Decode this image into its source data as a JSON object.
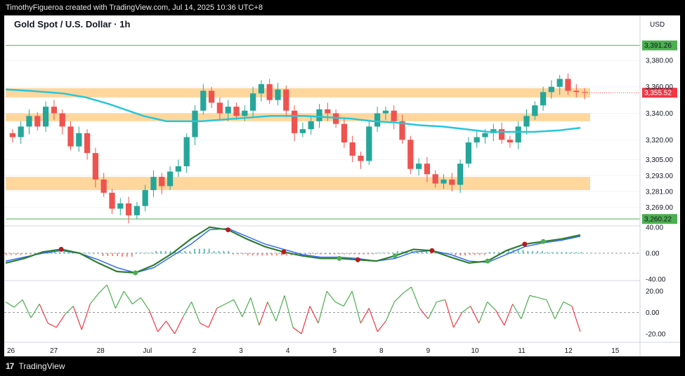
{
  "header": {
    "text": "TimothyFigueroa created with TradingView.com, Jul 14, 2025 10:36 UTC+8"
  },
  "footer": {
    "brand": "TradingView"
  },
  "chart_data": [
    {
      "type": "candlestick",
      "title": "Gold Spot / U.S. Dollar · 1h",
      "currency": "USD",
      "y_ticks": [
        3380.0,
        3360.0,
        3340.0,
        3320.0,
        3305.0,
        3293.0,
        3281.0,
        3269.0
      ],
      "y_tick_labels": [
        "3,380.00",
        "3,360.00",
        "3,340.00",
        "3,320.00",
        "3,305.00",
        "3,293.00",
        "3,281.00",
        "3,269.00"
      ],
      "ylim": [
        3255,
        3398
      ],
      "x_labels": [
        "26",
        "27",
        "28",
        "Jul",
        "2",
        "3",
        "4",
        "5",
        "8",
        "9",
        "10",
        "11",
        "12",
        "15"
      ],
      "horizontal_lines": [
        {
          "value": 3391.26,
          "label": "3,391.26",
          "color": "#4caf50"
        },
        {
          "value": 3260.22,
          "label": "3,260.22",
          "color": "#4caf50"
        }
      ],
      "last_price": {
        "value": 3355.52,
        "label": "3,355.52",
        "color": "#f23645"
      },
      "zones": [
        {
          "from": 3352,
          "to": 3359,
          "color": "#ffb74d"
        },
        {
          "from": 3334,
          "to": 3340,
          "color": "#ffb74d"
        },
        {
          "from": 3282,
          "to": 3292,
          "color": "#ffb74d"
        }
      ],
      "closes": [
        3322,
        3330,
        3338,
        3330,
        3345,
        3340,
        3330,
        3315,
        3325,
        3310,
        3290,
        3280,
        3268,
        3272,
        3263,
        3270,
        3282,
        3292,
        3285,
        3296,
        3300,
        3322,
        3342,
        3357,
        3348,
        3340,
        3345,
        3338,
        3342,
        3355,
        3362,
        3350,
        3358,
        3342,
        3325,
        3328,
        3334,
        3343,
        3340,
        3332,
        3318,
        3308,
        3304,
        3330,
        3340,
        3342,
        3334,
        3320,
        3298,
        3302,
        3294,
        3287,
        3290,
        3286,
        3302,
        3318,
        3322,
        3325,
        3328,
        3320,
        3318,
        3330,
        3338,
        3346,
        3356,
        3360,
        3366,
        3357,
        3356,
        3355.52
      ],
      "ma": {
        "color": "#26c6da",
        "values": [
          3358,
          3357,
          3355,
          3352,
          3347,
          3338,
          3334,
          3334,
          3336,
          3338,
          3338,
          3337,
          3336,
          3334,
          3333,
          3331,
          3330,
          3328,
          3326,
          3326,
          3326,
          3327,
          3329
        ]
      },
      "ma_x": [
        0,
        0.04,
        0.1,
        0.14,
        0.18,
        0.24,
        0.28,
        0.34,
        0.4,
        0.46,
        0.52,
        0.56,
        0.6,
        0.64,
        0.68,
        0.72,
        0.76,
        0.8,
        0.84,
        0.88,
        0.92,
        0.96,
        1.0
      ]
    },
    {
      "type": "line",
      "name": "oscillator-1",
      "y_ticks": [
        40.0,
        0.0,
        -40.0
      ],
      "y_tick_labels": [
        "40.00",
        "0.00",
        "-40.00"
      ],
      "ylim": [
        -42,
        42
      ],
      "fast_values": [
        -15,
        -8,
        2,
        6,
        0,
        -15,
        -28,
        -30,
        -18,
        0,
        22,
        40,
        36,
        22,
        10,
        2,
        -4,
        -8,
        -8,
        -10,
        -12,
        -4,
        6,
        4,
        -6,
        -15,
        -12,
        4,
        14,
        18,
        22,
        28
      ],
      "slow_values": [
        -12,
        -6,
        0,
        4,
        0,
        -10,
        -22,
        -30,
        -22,
        -4,
        14,
        36,
        38,
        26,
        14,
        6,
        -2,
        -6,
        -6,
        -8,
        -12,
        -8,
        2,
        4,
        -2,
        -12,
        -14,
        -2,
        10,
        16,
        20,
        26
      ],
      "markers": [
        {
          "index": 3,
          "color": "#b71c1c"
        },
        {
          "index": 7,
          "color": "#4caf50"
        },
        {
          "index": 12,
          "color": "#b71c1c"
        },
        {
          "index": 15,
          "color": "#b71c1c"
        },
        {
          "index": 18,
          "color": "#4caf50"
        },
        {
          "index": 19,
          "color": "#b71c1c"
        },
        {
          "index": 21,
          "color": "#4caf50"
        },
        {
          "index": 23,
          "color": "#b71c1c"
        },
        {
          "index": 26,
          "color": "#4caf50"
        },
        {
          "index": 28,
          "color": "#b71c1c"
        },
        {
          "index": 29,
          "color": "#4caf50"
        }
      ]
    },
    {
      "type": "line",
      "name": "oscillator-2",
      "y_ticks": [
        20.0,
        0.0,
        -20.0
      ],
      "y_tick_labels": [
        "20.00",
        "0.00",
        "-20.00"
      ],
      "ylim": [
        -28,
        30
      ],
      "values": [
        10,
        5,
        12,
        -5,
        8,
        -10,
        -14,
        -2,
        6,
        -16,
        8,
        18,
        26,
        4,
        20,
        8,
        14,
        2,
        -18,
        -8,
        -20,
        -4,
        10,
        -10,
        -14,
        4,
        8,
        12,
        -4,
        14,
        -12,
        10,
        -8,
        16,
        -14,
        -20,
        6,
        -10,
        20,
        10,
        6,
        20,
        -10,
        4,
        -18,
        -8,
        10,
        18,
        24,
        4,
        -6,
        10,
        12,
        -14,
        0,
        6,
        -10,
        10,
        2,
        -12,
        8,
        -6,
        16,
        14,
        12,
        -6,
        10,
        6,
        -18
      ]
    }
  ]
}
